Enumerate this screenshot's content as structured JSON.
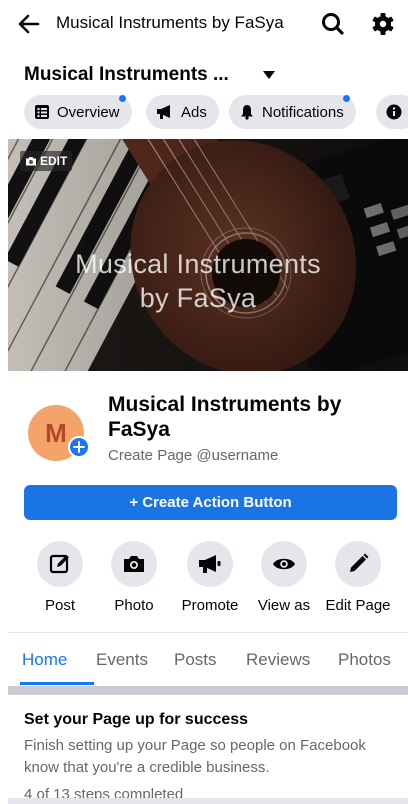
{
  "top_bar": {
    "title": "Musical Instruments by FaSya",
    "back_icon": "arrow-left-icon",
    "search_icon": "search-icon",
    "settings_icon": "gear-icon"
  },
  "page_header": {
    "name": "Musical Instruments ..."
  },
  "chips": [
    {
      "label": "Overview",
      "icon": "list-icon",
      "has_dot": true
    },
    {
      "label": "Ads",
      "icon": "megaphone-icon",
      "has_dot": false
    },
    {
      "label": "Notifications",
      "icon": "bell-icon",
      "has_dot": true
    },
    {
      "label": "",
      "icon": "info-icon",
      "has_dot": false
    }
  ],
  "cover": {
    "edit_label": "EDIT",
    "text_line1": "Musical Instruments",
    "text_line2": "by FaSya"
  },
  "profile": {
    "avatar_letter": "M",
    "name": "Musical Instruments by FaSya",
    "subtitle": "Create Page @username"
  },
  "action_button": {
    "label": "+ Create Action Button"
  },
  "quick_actions": [
    {
      "label": "Post",
      "icon": "compose-icon"
    },
    {
      "label": "Photo",
      "icon": "camera-icon"
    },
    {
      "label": "Promote",
      "icon": "megaphone-icon"
    },
    {
      "label": "View as",
      "icon": "eye-icon"
    },
    {
      "label": "Edit Page",
      "icon": "pencil-icon"
    }
  ],
  "tabs": [
    {
      "label": "Home",
      "active": true
    },
    {
      "label": "Events",
      "active": false
    },
    {
      "label": "Posts",
      "active": false
    },
    {
      "label": "Reviews",
      "active": false
    },
    {
      "label": "Photos",
      "active": false
    }
  ],
  "setup": {
    "title": "Set your Page up for success",
    "description": "Finish setting up your Page so people on Facebook know that you're a credible business.",
    "steps": "4 of 13 steps completed"
  },
  "colors": {
    "accent": "#1877f2",
    "button": "#1b74e4",
    "chip_bg": "#e4e6eb",
    "secondary_text": "#65676b",
    "avatar_bg": "#f4a46a"
  }
}
